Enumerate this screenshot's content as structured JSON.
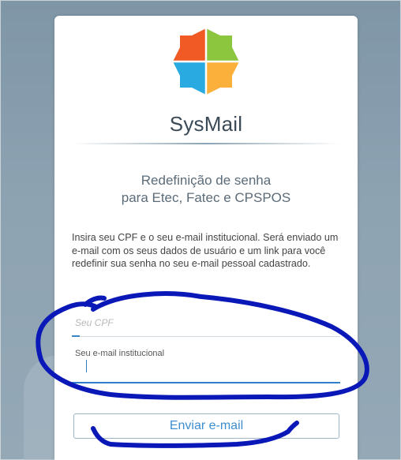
{
  "app": {
    "name": "SysMail"
  },
  "page": {
    "subtitle_line1": "Redefinição de senha",
    "subtitle_line2": "para Etec, Fatec e CPSPOS",
    "description": "Insira seu CPF e o seu e-mail institucional. Será enviado um e-mail com os seus dados de usuário e um link para você redefinir sua senha no seu e-mail pessoal cadastrado."
  },
  "form": {
    "cpf": {
      "placeholder": "Seu CPF",
      "value": ""
    },
    "email": {
      "label": "Seu e-mail institucional",
      "value": ""
    },
    "submit_label": "Enviar e-mail"
  },
  "colors": {
    "logo_top": "#f15a24",
    "logo_right": "#8cc63f",
    "logo_bottom_left": "#29abe2",
    "logo_bottom_right": "#fbb03b",
    "accent": "#2f80c8",
    "annotation_ink": "#0a18b8"
  },
  "icons": {
    "logo": "sysmail-logo-icon"
  }
}
